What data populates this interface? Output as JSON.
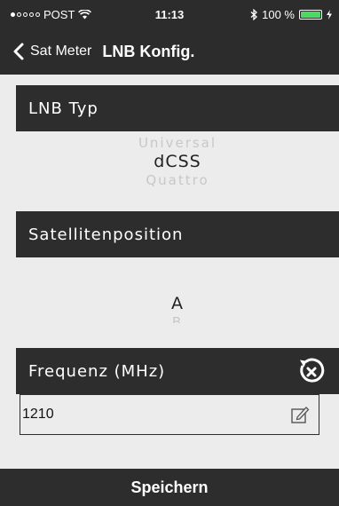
{
  "status_bar": {
    "carrier": "POST",
    "time": "11:13",
    "battery": "100 %",
    "battery_level": 1.0
  },
  "nav": {
    "back_label": "Sat Meter",
    "title": "LNB Konfig."
  },
  "lnb_type": {
    "header": "LNB Typ",
    "above": "Universal",
    "selected": "dCSS",
    "below": "Quattro"
  },
  "satellite_position": {
    "header": "Satellitenposition",
    "selected": "A",
    "below": "B"
  },
  "frequency": {
    "header": "Frequenz (MHz)",
    "value": "1210"
  },
  "footer": {
    "save_label": "Speichern"
  },
  "colors": {
    "bar_background": "#2d2d2d",
    "content_background": "#ececec",
    "battery_green": "#4cd964"
  }
}
